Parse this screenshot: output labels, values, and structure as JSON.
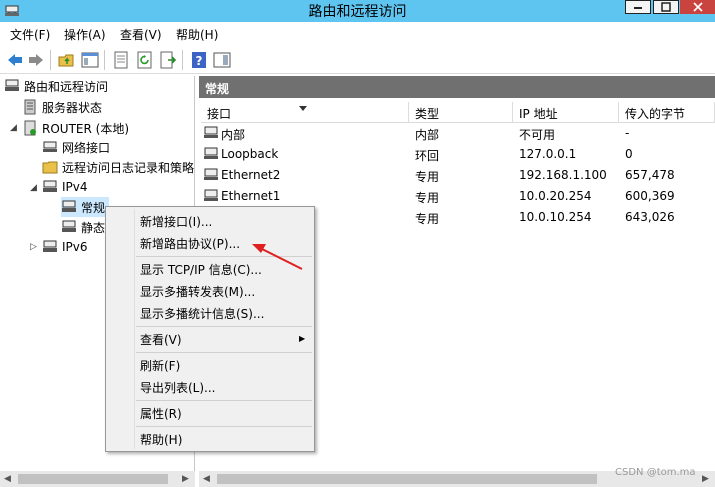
{
  "window": {
    "title": "路由和远程访问"
  },
  "menubar": {
    "items": [
      "文件(F)",
      "操作(A)",
      "查看(V)",
      "帮助(H)"
    ]
  },
  "tree": {
    "root": "路由和远程访问",
    "server_status": "服务器状态",
    "router": "ROUTER (本地)",
    "network_interfaces": "网络接口",
    "remote_access_log": "远程访问日志记录和策略",
    "ipv4": "IPv4",
    "general": "常规",
    "static": "静态",
    "ipv6": "IPv6"
  },
  "pane": {
    "title": "常规",
    "columns": [
      "接口",
      "类型",
      "IP 地址",
      "传入的字节"
    ],
    "rows": [
      {
        "interface": "内部",
        "type": "内部",
        "ip": "不可用",
        "bytes_in": "-"
      },
      {
        "interface": "Loopback",
        "type": "环回",
        "ip": "127.0.0.1",
        "bytes_in": "0"
      },
      {
        "interface": "Ethernet2",
        "type": "专用",
        "ip": "192.168.1.100",
        "bytes_in": "657,478"
      },
      {
        "interface": "Ethernet1",
        "type": "专用",
        "ip": "10.0.20.254",
        "bytes_in": "600,369"
      },
      {
        "interface": "",
        "type": "专用",
        "ip": "10.0.10.254",
        "bytes_in": "643,026"
      }
    ]
  },
  "context_menu": {
    "new_interface": "新增接口(I)...",
    "new_routing_protocol": "新增路由协议(P)...",
    "show_tcpip": "显示 TCP/IP 信息(C)...",
    "show_multicast_forwarding": "显示多播转发表(M)...",
    "show_multicast_stats": "显示多播统计信息(S)...",
    "view": "查看(V)",
    "refresh": "刷新(F)",
    "export_list": "导出列表(L)...",
    "properties": "属性(R)",
    "help": "帮助(H)"
  },
  "watermark": "CSDN @tom.ma",
  "colors": {
    "titlebar": "#5ec4f0",
    "close": "#c9433f",
    "pane_header": "#707070",
    "annotation_arrow": "#e02020"
  }
}
